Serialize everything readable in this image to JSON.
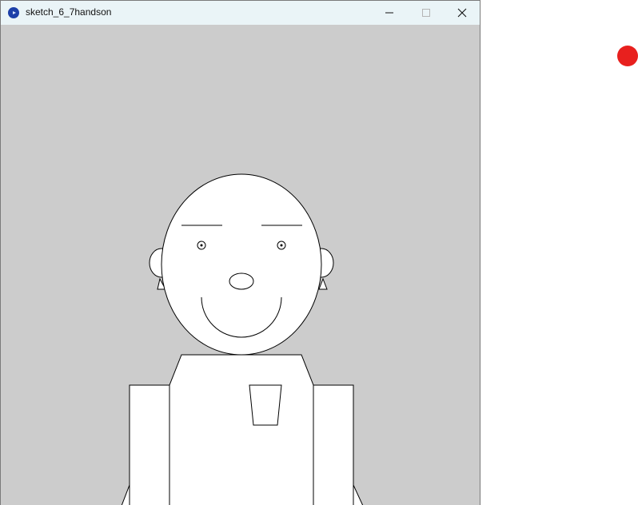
{
  "window": {
    "title": "sketch_6_7handson",
    "icon": "processing-app-icon",
    "controls": [
      "minimize-icon",
      "maximize-icon",
      "close-icon"
    ]
  },
  "canvas": {
    "background": "#cccccc",
    "stroke": "#000000",
    "fill": "#ffffff"
  },
  "indicator": {
    "color": "#e8201e"
  }
}
